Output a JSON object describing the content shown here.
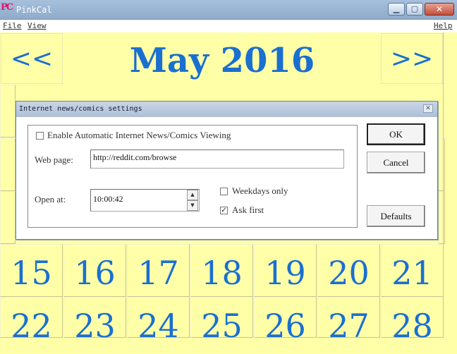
{
  "window": {
    "title": "PinkCal",
    "icon_text": "PC",
    "controls": {
      "minimize": "▁",
      "maximize": "▢",
      "close": "✕"
    }
  },
  "menu": {
    "file": "File",
    "view": "View",
    "help": "Help"
  },
  "calendar": {
    "month_title": "May 2016",
    "prev_label": "<<",
    "next_label": ">>",
    "row3": [
      "15",
      "16",
      "17",
      "18",
      "19",
      "20",
      "21"
    ],
    "row4": [
      "22",
      "23",
      "24",
      "25",
      "26",
      "27",
      "28"
    ]
  },
  "dialog": {
    "title": "Internet news/comics settings",
    "close": "✕",
    "enable_label": "Enable Automatic Internet News/Comics Viewing",
    "enable_checked": false,
    "webpage_label": "Web page:",
    "webpage_value": "http://reddit.com/browse",
    "open_at_label": "Open at:",
    "open_at_value": "10:00:42",
    "weekdays_label": "Weekdays only",
    "weekdays_checked": false,
    "ask_first_label": "Ask first",
    "ask_first_checked": true,
    "ok": "OK",
    "cancel": "Cancel",
    "defaults": "Defaults"
  },
  "icons": {
    "spin_up": "▲",
    "spin_down": "▼",
    "check": "✓"
  },
  "colors": {
    "calendar_bg": "#ffffa8",
    "date_text": "#1a6fd0"
  }
}
